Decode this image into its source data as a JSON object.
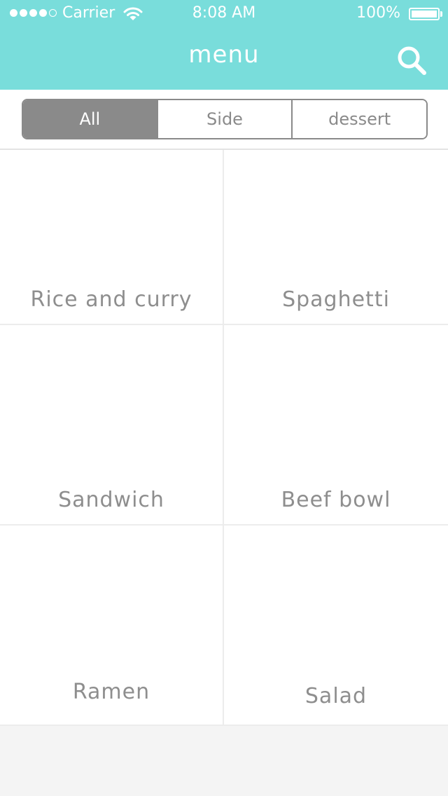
{
  "status_bar": {
    "carrier": "Carrier",
    "time": "8:08 AM",
    "battery": "100%",
    "signal_bars_filled": 4,
    "signal_bars_total": 5,
    "wifi_icon": "wifi-icon",
    "battery_level": 1.0
  },
  "nav": {
    "title": "menu",
    "search_icon": "search-icon"
  },
  "segments": [
    {
      "label": "All",
      "selected": true
    },
    {
      "label": "Side",
      "selected": false
    },
    {
      "label": "dessert",
      "selected": false
    }
  ],
  "menu_items": [
    {
      "name": "Rice and curry"
    },
    {
      "name": "Spaghetti"
    },
    {
      "name": "Sandwich"
    },
    {
      "name": "Beef bowl"
    },
    {
      "name": "Ramen"
    },
    {
      "name": "Salad"
    }
  ],
  "colors": {
    "header": "#79DDDB",
    "segment_selected": "#8a8a8a",
    "text_gray": "#8e8e8e",
    "footer_bg": "#f4f4f4"
  }
}
